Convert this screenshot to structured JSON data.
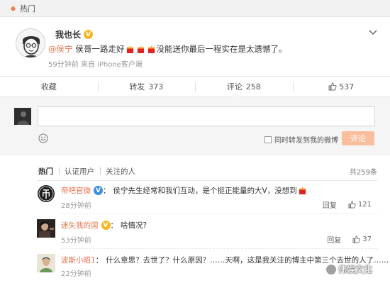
{
  "topbar": {
    "title": "热门"
  },
  "post": {
    "author": "我也长",
    "mention": "@侯宁",
    "text": "侯哥一路走好",
    "text_after": "没能送你最后一程实在是太遗憾了。",
    "meta": "59分钟前  来自 iPhone客户端"
  },
  "actions": {
    "favorite": "收藏",
    "repost_label": "转发",
    "repost_count": "373",
    "comment_label": "评论",
    "comment_count": "258",
    "like_count": "537"
  },
  "composer": {
    "repost_checkbox": "同时转发到我的微博",
    "submit": "评论"
  },
  "filter": {
    "tabs": [
      "热门",
      "认证用户",
      "关注的人"
    ],
    "total": "共259条"
  },
  "comments": [
    {
      "user": "帝吧官微",
      "text": "侯宁先生经常和我们互动，是个挺正能量的大V，没想到",
      "time": "28分钟前",
      "reply": "回复",
      "likes": "121"
    },
    {
      "user": "迷失我的国",
      "text": "啥情况?",
      "time": "53分钟前",
      "reply": "回复",
      "likes": "37"
    },
    {
      "user": "波斯小昭1",
      "text": "什么意思？去世了？什么原因？……天啊，这是我关注的博主中第三个去世的人了……",
      "time": "22分钟前",
      "reply": "",
      "likes": ""
    }
  ],
  "watermark": "伟娱文化",
  "colors": {
    "accent": "#eb7350",
    "gold_v": "#f3b821",
    "blue_v": "#3b8fe0",
    "submit_bg": "#f8be9e"
  }
}
